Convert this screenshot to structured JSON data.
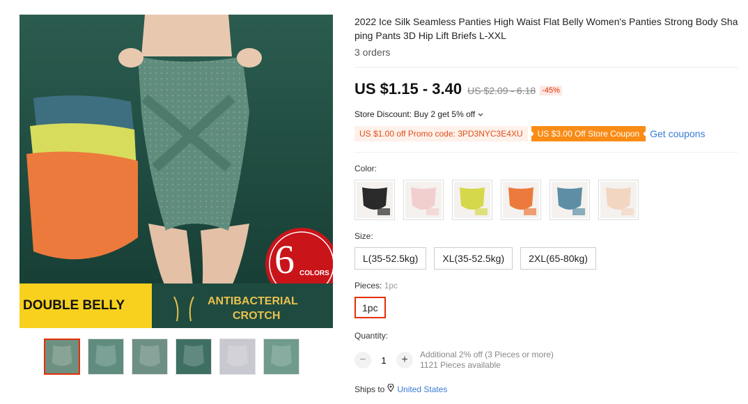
{
  "product": {
    "title": "2022 Ice Silk Seamless Panties High Waist Flat Belly Women's Panties Strong Body Shaping Pants 3D Hip Lift Briefs L-XXL",
    "orders": "3 orders"
  },
  "pricing": {
    "price": "US $1.15 - 3.40",
    "original_price": "US $2.09 - 6.18",
    "discount": "-45%",
    "store_discount": "Store Discount: Buy 2 get 5% off",
    "store_discount_icon": "chevron-down-icon",
    "promo_code": "US $1.00 off Promo code: 3PD3NYC3E4XU",
    "store_coupon": "US $3.00 Off Store Coupon",
    "get_coupons": "Get coupons",
    "colors": {
      "price": "#111111",
      "discount": "#e62e04",
      "coupon": "#fa8c16",
      "link": "#3a7bd5"
    }
  },
  "gallery": {
    "main_overlay": {
      "number": "6",
      "colors_word": "COLORS",
      "double_belly": "DOUBLE BELLY",
      "antibacterial": "ANTIBACTERIAL",
      "crotch": "CROTCH"
    },
    "thumbnails": [
      {
        "color": "#6e9080",
        "active": true
      },
      {
        "color": "#5f8c7e",
        "active": false
      },
      {
        "color": "#6d8f84",
        "active": false
      },
      {
        "color": "#3f6f63",
        "active": false
      },
      {
        "color": "#c8c8d0",
        "active": false
      },
      {
        "color": "#6f9a8c",
        "active": false
      }
    ]
  },
  "options": {
    "color_label": "Color:",
    "color_swatches": [
      {
        "name": "black",
        "color": "#2a2a2a"
      },
      {
        "name": "pink",
        "color": "#f2cfcf"
      },
      {
        "name": "yellow",
        "color": "#d5d84a"
      },
      {
        "name": "orange",
        "color": "#ec7a3c"
      },
      {
        "name": "blue",
        "color": "#5d8ea5"
      },
      {
        "name": "skin",
        "color": "#f2d6c2"
      }
    ],
    "size_label": "Size:",
    "sizes": [
      "L(35-52.5kg)",
      "XL(35-52.5kg)",
      "2XL(65-80kg)"
    ],
    "pieces_label": "Pieces:",
    "pieces_selected": "1pc",
    "pieces": [
      "1pc"
    ]
  },
  "quantity": {
    "label": "Quantity:",
    "minus": "−",
    "plus": "+",
    "value": "1",
    "additional": "Additional 2% off (3 Pieces or more)",
    "available": "1121 Pieces available"
  },
  "shipping": {
    "label": "Ships to",
    "icon": "location-pin-icon",
    "country": "United States"
  }
}
